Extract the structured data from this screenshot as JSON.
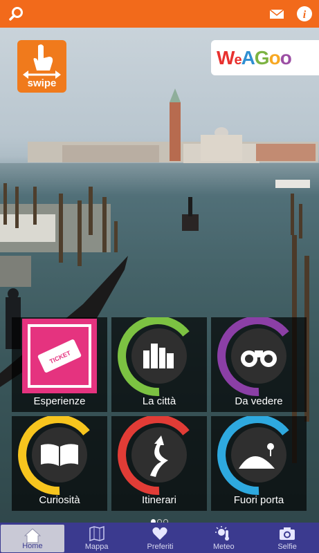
{
  "header": {
    "search_icon": "search-icon",
    "mail_icon": "mail-icon",
    "info_icon": "info-icon",
    "color": "#f26a1b"
  },
  "badge": {
    "label": "swipe"
  },
  "logo": {
    "parts": [
      "W",
      "e",
      "A",
      "G",
      "o",
      "o"
    ]
  },
  "tiles": [
    {
      "label": "Esperienze",
      "icon": "ticket-icon",
      "accent": "#e5337f",
      "inner_text": "TICKET"
    },
    {
      "label": "La città",
      "icon": "city-icon",
      "accent": "#7cc242"
    },
    {
      "label": "Da vedere",
      "icon": "binoculars-icon",
      "accent": "#8b3fa6"
    },
    {
      "label": "Curiosità",
      "icon": "book-icon",
      "accent": "#f7c51e"
    },
    {
      "label": "Itinerari",
      "icon": "winding-road-icon",
      "accent": "#e13c36"
    },
    {
      "label": "Fuori porta",
      "icon": "hill-icon",
      "accent": "#2ea9df"
    }
  ],
  "pager": {
    "pages": 3,
    "current": 1
  },
  "nav": [
    {
      "label": "Home",
      "icon": "home-icon",
      "active": true
    },
    {
      "label": "Mappa",
      "icon": "map-icon",
      "active": false
    },
    {
      "label": "Preferiti",
      "icon": "heart-icon",
      "active": false
    },
    {
      "label": "Meteo",
      "icon": "weather-icon",
      "active": false
    },
    {
      "label": "Selfie",
      "icon": "camera-icon",
      "active": false
    }
  ]
}
